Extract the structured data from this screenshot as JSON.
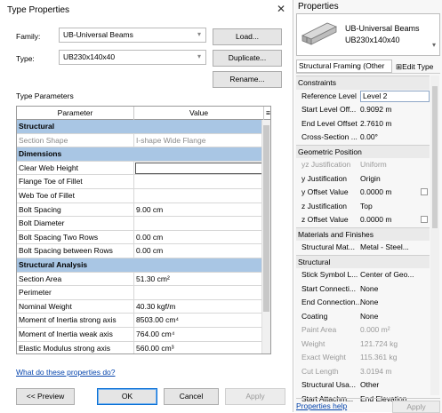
{
  "dialog": {
    "title": "Type Properties",
    "close": "✕",
    "family_label": "Family:",
    "family_value": "UB-Universal Beams",
    "type_label": "Type:",
    "type_value": "UB230x140x40",
    "load_button": "Load...",
    "duplicate_button": "Duplicate...",
    "rename_button": "Rename...",
    "type_parameters_label": "Type Parameters",
    "col_parameter": "Parameter",
    "col_value": "Value",
    "col_menu": "≡",
    "rows": [
      {
        "kind": "section",
        "p": "Structural",
        "v": ""
      },
      {
        "kind": "ro",
        "p": "Section Shape",
        "v": "I-shape Wide Flange"
      },
      {
        "kind": "section",
        "p": "Dimensions",
        "v": ""
      },
      {
        "kind": "edit",
        "p": "Clear Web Height",
        "v": ""
      },
      {
        "kind": "",
        "p": "Flange Toe of Fillet",
        "v": ""
      },
      {
        "kind": "",
        "p": "Web Toe of Fillet",
        "v": ""
      },
      {
        "kind": "",
        "p": "Bolt Spacing",
        "v": "9.00 cm"
      },
      {
        "kind": "",
        "p": "Bolt Diameter",
        "v": ""
      },
      {
        "kind": "",
        "p": "Bolt Spacing Two Rows",
        "v": "0.00 cm"
      },
      {
        "kind": "",
        "p": "Bolt Spacing between Rows",
        "v": "0.00 cm"
      },
      {
        "kind": "section",
        "p": "Structural Analysis",
        "v": ""
      },
      {
        "kind": "",
        "p": "Section Area",
        "v": "51.30 cm²"
      },
      {
        "kind": "",
        "p": "Perimeter",
        "v": ""
      },
      {
        "kind": "",
        "p": "Nominal Weight",
        "v": "40.30 kgf/m"
      },
      {
        "kind": "",
        "p": "Moment of Inertia strong axis",
        "v": "8503.00 cm⁴"
      },
      {
        "kind": "",
        "p": "Moment of Inertia weak axis",
        "v": "764.00 cm⁴"
      },
      {
        "kind": "",
        "p": "Elastic Modulus strong axis",
        "v": "560.00 cm³"
      },
      {
        "kind": "",
        "p": "Elastic Modulus weak axis",
        "v": "92.60 cm³"
      }
    ],
    "help_link": "What do these properties do?",
    "preview_button": "<< Preview",
    "ok_button": "OK",
    "cancel_button": "Cancel",
    "apply_button": "Apply"
  },
  "props": {
    "title": "Properties",
    "type_name_line1": "UB-Universal Beams",
    "type_name_line2": "UB230x140x40",
    "type_dropdown": "▾",
    "filter_value": "Structural Framing (Other",
    "edit_type": "Edit Type",
    "rows": [
      {
        "kind": "group",
        "k": "Constraints",
        "v": ""
      },
      {
        "kind": "",
        "k": "Reference Level",
        "v": "Level 2",
        "box": true
      },
      {
        "kind": "",
        "k": "Start Level Off...",
        "v": "0.9092 m"
      },
      {
        "kind": "",
        "k": "End Level Offset",
        "v": "2.7610 m"
      },
      {
        "kind": "",
        "k": "Cross-Section ...",
        "v": "0.00°"
      },
      {
        "kind": "group",
        "k": "Geometric Position",
        "v": ""
      },
      {
        "kind": "dis",
        "k": "yz Justification",
        "v": "Uniform"
      },
      {
        "kind": "",
        "k": "y Justification",
        "v": "Origin"
      },
      {
        "kind": "",
        "k": "y Offset Value",
        "v": "0.0000 m",
        "chk": true
      },
      {
        "kind": "",
        "k": "z Justification",
        "v": "Top"
      },
      {
        "kind": "",
        "k": "z Offset Value",
        "v": "0.0000 m",
        "chk": true
      },
      {
        "kind": "group",
        "k": "Materials and Finishes",
        "v": ""
      },
      {
        "kind": "",
        "k": "Structural Mat...",
        "v": "Metal - Steel..."
      },
      {
        "kind": "group",
        "k": "Structural",
        "v": ""
      },
      {
        "kind": "",
        "k": "Stick Symbol L...",
        "v": "Center of Geo..."
      },
      {
        "kind": "",
        "k": "Start Connecti...",
        "v": "None"
      },
      {
        "kind": "",
        "k": "End Connection...",
        "v": "None"
      },
      {
        "kind": "",
        "k": "Coating",
        "v": "None"
      },
      {
        "kind": "dis",
        "k": "Paint Area",
        "v": "0.000 m²"
      },
      {
        "kind": "dis",
        "k": "Weight",
        "v": "121.724 kg"
      },
      {
        "kind": "dis",
        "k": "Exact Weight",
        "v": "115.361 kg"
      },
      {
        "kind": "dis",
        "k": "Cut Length",
        "v": "3.0194 m"
      },
      {
        "kind": "",
        "k": "Structural Usa...",
        "v": "Other"
      },
      {
        "kind": "",
        "k": "Start Attachm...",
        "v": "End Elevation"
      }
    ],
    "help_link": "Properties help",
    "apply_button": "Apply"
  }
}
